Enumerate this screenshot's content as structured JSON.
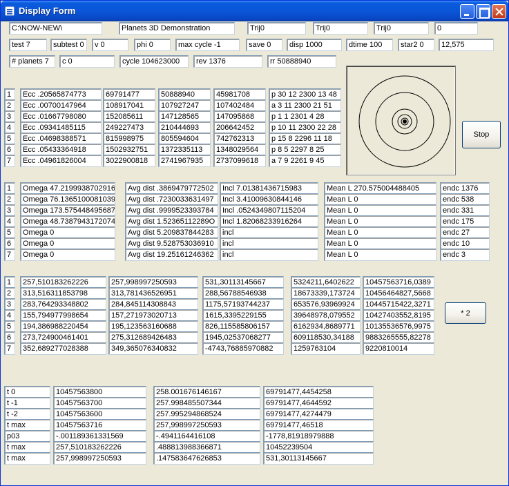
{
  "window": {
    "title": "Display Form"
  },
  "row1": [
    "C:\\NOW-NEW\\",
    "Planets 3D Demonstration",
    "Trij0",
    "Trij0",
    "Trij0",
    "0"
  ],
  "row2": [
    "test  7",
    "subtest  0",
    "v  0",
    "phi 0",
    "max cycle -1",
    "save 0",
    "disp  1000",
    "dtime  100",
    "star2  0",
    "12,575"
  ],
  "row3": [
    "# planets  7",
    "c  0",
    "cycle  104623000",
    "rev  1376",
    "rr  50888940"
  ],
  "table1": [
    [
      "1",
      "Ecc .20565874773",
      "69791477",
      "50888940",
      "45981708",
      "p 30 12 2300 13 48"
    ],
    [
      "2",
      "Ecc .00700147964",
      "108917041",
      "107927247",
      "107402484",
      "a  3 11 2300 21 51"
    ],
    [
      "3",
      "Ecc .01667798080",
      "152085611",
      "147128565",
      "147095868",
      "p  1  1 2301  4 28"
    ],
    [
      "4",
      "Ecc .09341485115",
      "249227473",
      "210444693",
      "206642452",
      "p 10 11 2300 22 28"
    ],
    [
      "5",
      "Ecc .04698388571",
      "815998975",
      "805594604",
      "742762313",
      "p 15  8 2296 11 18"
    ],
    [
      "6",
      "Ecc .05433364918",
      "1502932751",
      "1372335113",
      "1348029564",
      "p  8  5 2297  8 25"
    ],
    [
      "7",
      "Ecc .04961826004",
      "3022900818",
      "2741967935",
      "2737099618",
      "a  7  9 2261  9 45"
    ]
  ],
  "table2": [
    [
      "1",
      "Omega 47.2199938702916",
      "Avg dist .3869479772502",
      "Incl 7.01381436715983",
      "Mean L 270.575004488405",
      "endc 1376"
    ],
    [
      "2",
      "Omega 76.1365100081039",
      "Avg dist .7230033631497",
      "Incl 3.41009630844146",
      "Mean L 0",
      "endc 538"
    ],
    [
      "3",
      "Omega 173.575448495687",
      "Avg dist .9999523393784",
      "Incl .0524349807115204",
      "Mean L 0",
      "endc 331"
    ],
    [
      "4",
      "Omega 48.7387943172074",
      "Avg dist 1.52365112289O",
      "Incl 1.82068233916264",
      "Mean L 0",
      "endc 175"
    ],
    [
      "5",
      "Omega  0",
      "Avg dist 5.209837844283",
      "incl",
      "Mean L 0",
      "endc 27"
    ],
    [
      "6",
      "Omega  0",
      "Avg dist 9.528753036910",
      "incl",
      "Mean L 0",
      "endc 10"
    ],
    [
      "7",
      "Omega  0",
      "Avg dist 19.25161246362",
      "incl",
      "Mean L 0",
      "endc 3"
    ]
  ],
  "table3": [
    [
      "1",
      "257,510183262226",
      "257,998997250593",
      "531,30113145667",
      "5324211,6402622",
      "10457563716,0389"
    ],
    [
      "2",
      "313,516311853798",
      "313,781436526951",
      "288,56788546938",
      "18673339,173724",
      "10456464827,5668"
    ],
    [
      "3",
      "283,764293348802",
      "284,845114308843",
      "1175,57193744237",
      "653576,93969924",
      "10445715422,3271"
    ],
    [
      "4",
      "155,794977998654",
      "157,271973020713",
      "1615,3395229155",
      "39648978,079552",
      "10427403552,8195"
    ],
    [
      "5",
      "194,386988220454",
      "195,123563160688",
      "826,115585806157",
      "6162934,8689771",
      "10135536576,9975"
    ],
    [
      "6",
      "273,724900461401",
      "275,312689426483",
      "1945,02537068277",
      "609118530,34188",
      "9883265555,82278"
    ],
    [
      "7",
      "352,689277028388",
      "349,365076340832",
      "-4743,76885970882",
      "1259763104",
      "9220810014"
    ]
  ],
  "table4": [
    [
      "t  0",
      "10457563800",
      "258.001676146167",
      "69791477,4454258"
    ],
    [
      "t -1",
      "10457563700",
      "257.998485507344",
      "69791477,4644592"
    ],
    [
      "t -2",
      "10457563600",
      "257.995294868524",
      "69791477,4274479"
    ],
    [
      "t max",
      "10457563716",
      "257,998997250593",
      "69791477,46518"
    ],
    [
      "p03",
      "-.001189361331569",
      "-.4941164416108",
      "-1778,81918979888"
    ],
    [
      "t max",
      "257,510183262226",
      ".488813988366871",
      "10452239504"
    ],
    [
      "t max",
      "257,998997250593",
      ".147583647626853",
      "531,30113145667"
    ]
  ],
  "buttons": {
    "stop": "Stop",
    "x2": "* 2"
  }
}
